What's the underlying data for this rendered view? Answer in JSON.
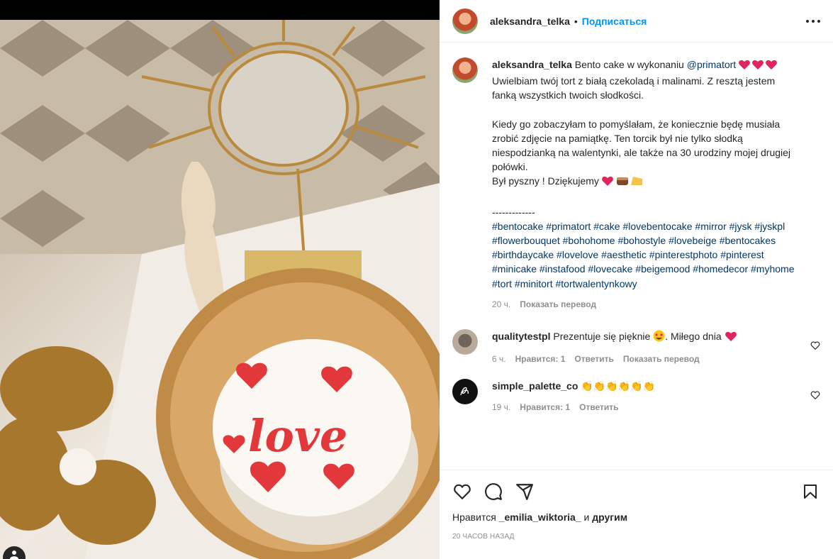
{
  "post": {
    "author": "aleksandra_telka",
    "follow_label": "Подписаться",
    "separator": "•"
  },
  "caption": {
    "author": "aleksandra_telka",
    "text_before": "Bento cake w wykonaniu ",
    "mention": "@primatort",
    "line2": "Uwielbiam twój tort z białą czekoladą i malinami. Z resztą jestem fanką wszystkich twoich słodkości.",
    "paragraph2": "Kiedy go zobaczyłam to pomyślałam, że koniecznie będę musiała zrobić zdjęcie na pamiątkę. Ten torcik był nie tylko słodką niespodzianką na walentynki, ale także na 30 urodziny mojej drugiej połówki.",
    "closing": "Był pyszny ! Dziękujemy ",
    "divider": "-------------",
    "hashtags": "#bentocake #primatort #cake #lovebentocake #mirror #jysk #jyskpl #flowerbouquet #bohohome #bohostyle #lovebeige #bentocakes #birthdaycake #lovelove #aesthetic #pinterestphoto #pinterest #minicake #instafood #lovecake #beigemood #homedecor #myhome #tort #minitort #tortwalentynkowy",
    "time": "20 ч.",
    "translate": "Показать перевод"
  },
  "comments": [
    {
      "author": "qualitytestpl",
      "text_before": "Prezentuje się pięknie ",
      "text_after": ". Miłego dnia ",
      "time": "6 ч.",
      "likes": "Нравится: 1",
      "reply": "Ответить",
      "translate": "Показать перевод"
    },
    {
      "author": "simple_palette_co",
      "text": "👏👏👏👏👏👏",
      "time": "19 ч.",
      "likes": "Нравится: 1",
      "reply": "Ответить"
    }
  ],
  "likes": {
    "prefix": "Нравится ",
    "user": "_emilia_wiktoria_",
    "middle": " и ",
    "others": "другим"
  },
  "timestamp": "20 часов назад",
  "colors": {
    "link": "#00376b",
    "follow": "#0095f6",
    "muted": "#8e8e8e",
    "heart": "#ed4956"
  },
  "icons": [
    "like-icon",
    "comment-icon",
    "share-icon",
    "save-icon",
    "more-icon",
    "heart-small-icon"
  ]
}
